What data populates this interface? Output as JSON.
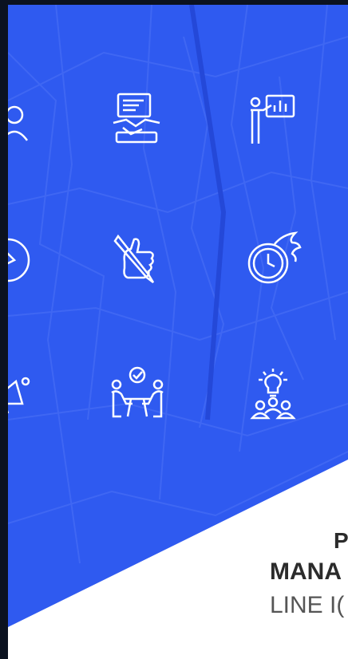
{
  "colors": {
    "background": "#2f5af0",
    "roads": "#4168f4",
    "icon_stroke": "#ffffff",
    "text": "#2b2b2b",
    "white": "#ffffff"
  },
  "icons": [
    {
      "name": "user-icon"
    },
    {
      "name": "handshake-contract-icon"
    },
    {
      "name": "presentation-icon"
    },
    {
      "name": "compass-icon"
    },
    {
      "name": "thumbs-up-pen-icon"
    },
    {
      "name": "fast-clock-icon"
    },
    {
      "name": "megaphone-icon"
    },
    {
      "name": "meeting-approval-icon"
    },
    {
      "name": "team-idea-icon"
    }
  ],
  "title": {
    "line1": "P",
    "line2": "MANA",
    "line3": "LINE I("
  }
}
